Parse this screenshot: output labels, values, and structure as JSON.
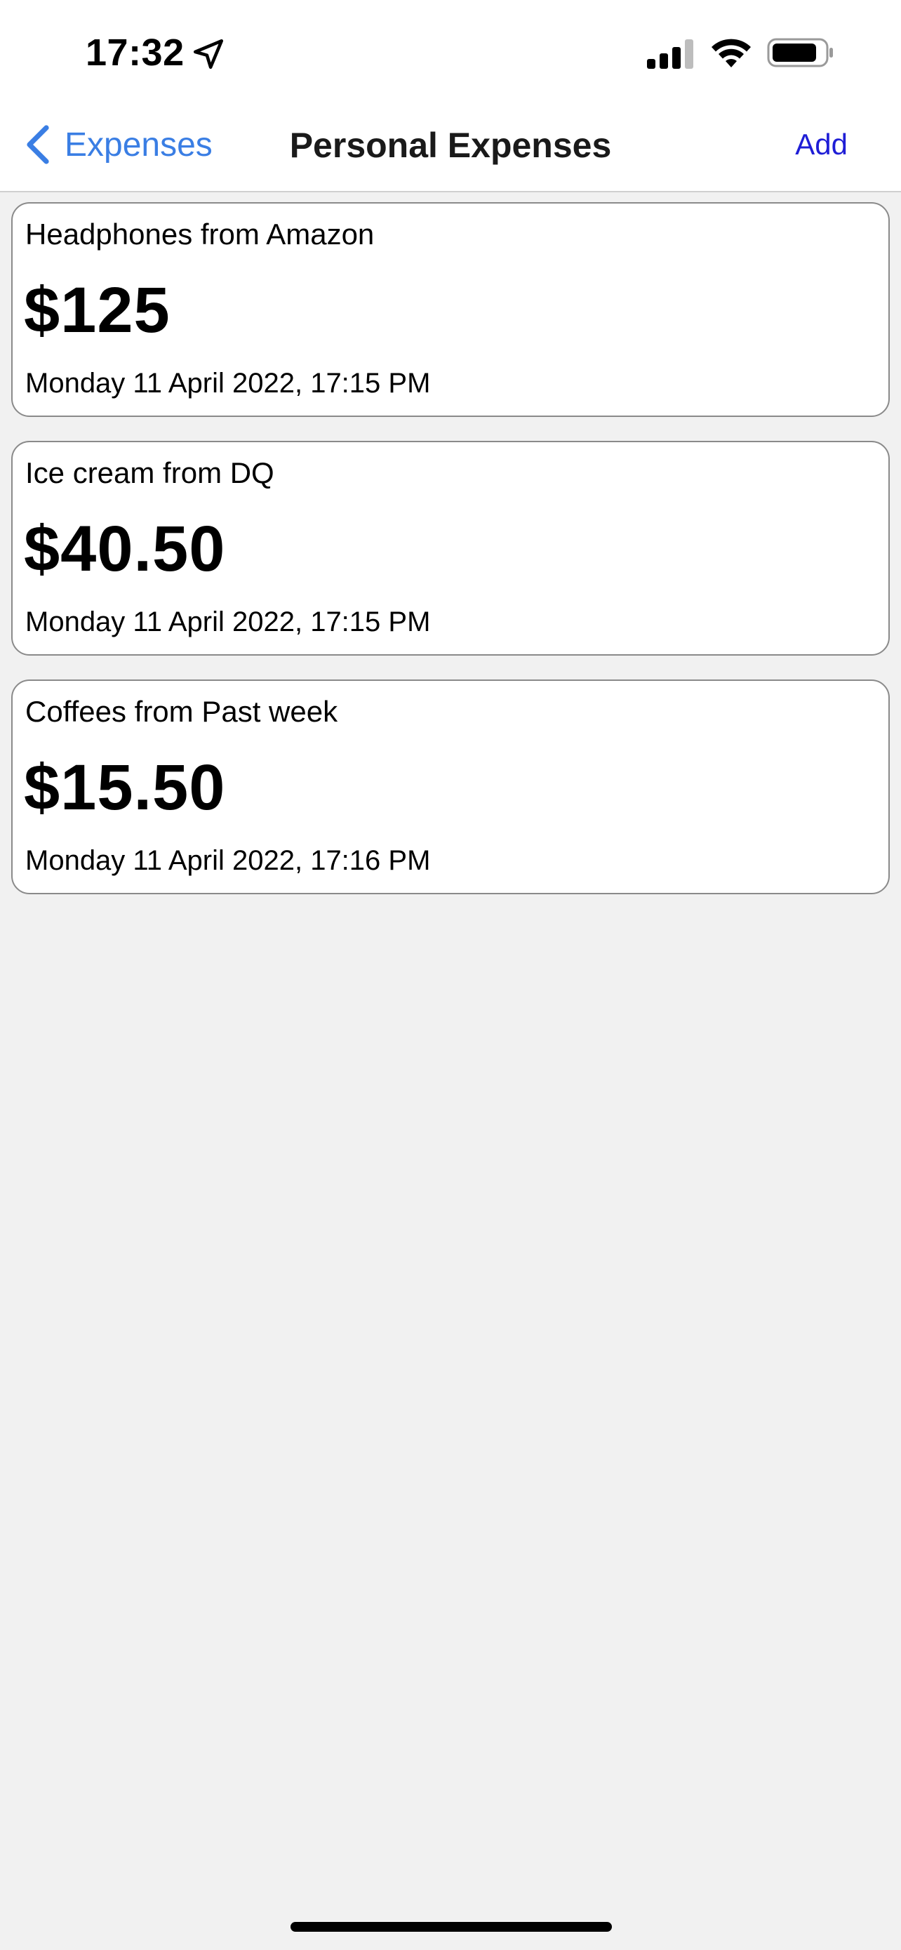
{
  "status_bar": {
    "time": "17:32",
    "location_icon": "location-arrow-icon",
    "signal_icon": "cellular-signal-icon",
    "wifi_icon": "wifi-icon",
    "battery_icon": "battery-icon"
  },
  "nav": {
    "back_label": "Expenses",
    "title": "Personal Expenses",
    "add_label": "Add",
    "accent_color": "#3a7ee4",
    "add_color": "#1f1ed6"
  },
  "expenses": [
    {
      "title": "Headphones from Amazon",
      "amount": "$125",
      "date": "Monday 11 April 2022, 17:15 PM"
    },
    {
      "title": "Ice cream from DQ",
      "amount": "$40.50",
      "date": "Monday 11 April 2022, 17:15 PM"
    },
    {
      "title": "Coffees from Past week",
      "amount": "$15.50",
      "date": "Monday 11 April 2022, 17:16 PM"
    }
  ]
}
